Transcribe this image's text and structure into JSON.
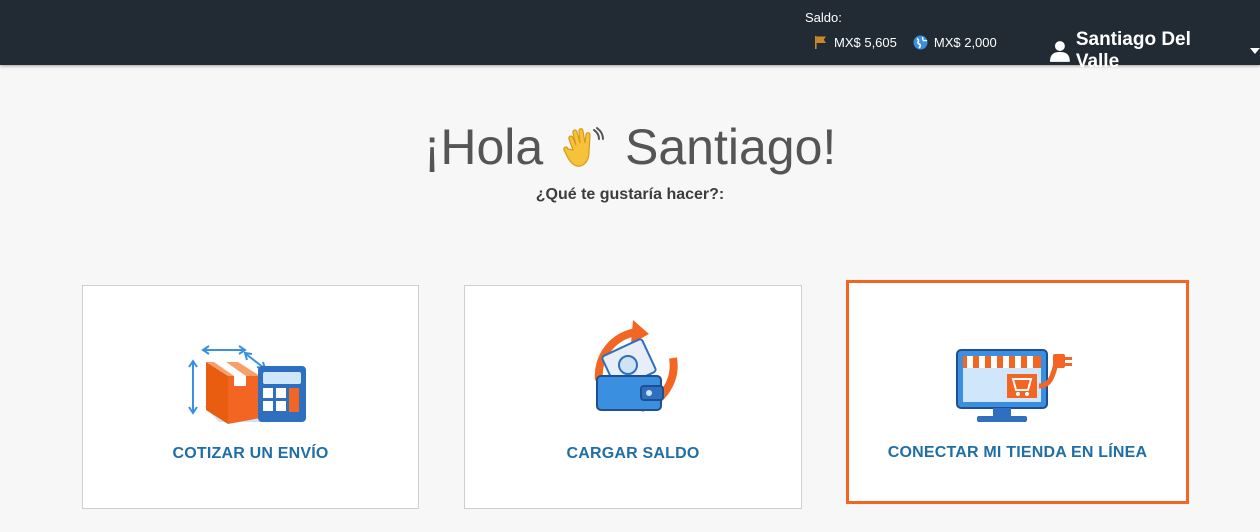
{
  "header": {
    "balance_label": "Saldo:",
    "balances": [
      {
        "icon": "flag-icon",
        "value": "MX$ 5,605",
        "color": "#c8872b"
      },
      {
        "icon": "globe-icon",
        "value": "MX$ 2,000",
        "color": "#3b8fe0"
      }
    ],
    "user": {
      "name": "Santiago Del Valle",
      "icon": "user-icon"
    }
  },
  "main": {
    "greeting_pre": "¡Hola",
    "greeting_post": "Santiago!",
    "greeting_icon": "waving-hand-icon",
    "subtitle": "¿Qué te gustaría hacer?:"
  },
  "cards": [
    {
      "label": "COTIZAR UN ENVÍO",
      "icon": "box-calculator-icon",
      "selected": false
    },
    {
      "label": "CARGAR SALDO",
      "icon": "wallet-refresh-icon",
      "selected": false
    },
    {
      "label": "CONECTAR MI TIENDA EN LÍNEA",
      "icon": "online-store-icon",
      "selected": true
    }
  ],
  "colors": {
    "topbar": "#222a33",
    "accent": "#f26522",
    "link_blue": "#1f6ea5",
    "icon_blue": "#3a8fe0"
  }
}
